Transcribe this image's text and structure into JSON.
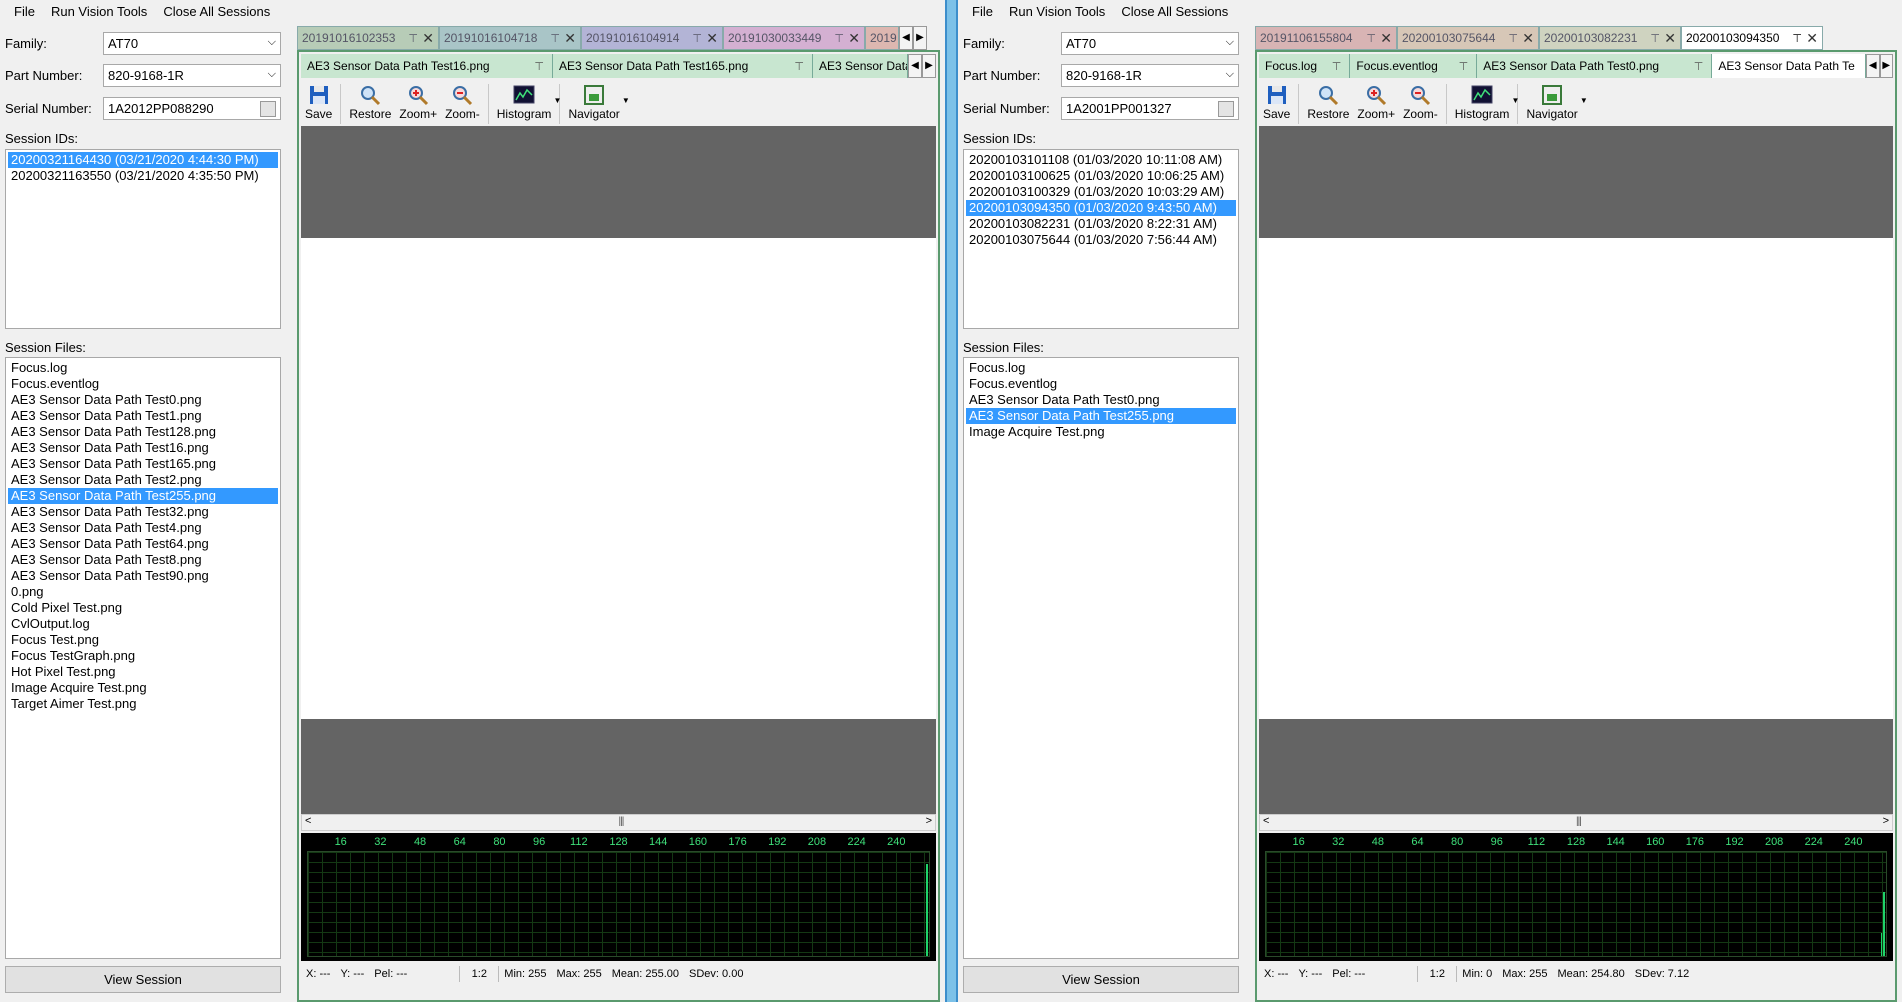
{
  "left": {
    "menu": [
      "File",
      "Run Vision Tools",
      "Close All Sessions"
    ],
    "family_label": "Family:",
    "family_value": "AT70",
    "part_label": "Part Number:",
    "part_value": "820-9168-1R",
    "serial_label": "Serial Number:",
    "serial_value": "1A2012PP088290",
    "session_ids_label": "Session IDs:",
    "session_ids": [
      "20200321164430 (03/21/2020 4:44:30 PM)",
      "20200321163550 (03/21/2020 4:35:50 PM)"
    ],
    "session_ids_selected": 0,
    "session_files_label": "Session Files:",
    "session_files": [
      "Focus.log",
      "Focus.eventlog",
      "AE3 Sensor Data Path Test0.png",
      "AE3 Sensor Data Path Test1.png",
      "AE3 Sensor Data Path Test128.png",
      "AE3 Sensor Data Path Test16.png",
      "AE3 Sensor Data Path Test165.png",
      "AE3 Sensor Data Path Test2.png",
      "AE3 Sensor Data Path Test255.png",
      "AE3 Sensor Data Path Test32.png",
      "AE3 Sensor Data Path Test4.png",
      "AE3 Sensor Data Path Test64.png",
      "AE3 Sensor Data Path Test8.png",
      "AE3 Sensor Data Path Test90.png",
      "0.png",
      "Cold Pixel Test.png",
      "CvlOutput.log",
      "Focus Test.png",
      "Focus TestGraph.png",
      "Hot Pixel Test.png",
      "Image Acquire Test.png",
      "Target Aimer Test.png"
    ],
    "session_files_selected": 8,
    "view_session": "View Session",
    "session_tabs": [
      {
        "label": "20191016102353",
        "color": "#b7ccb7"
      },
      {
        "label": "20191016104718",
        "color": "#a9c5c7"
      },
      {
        "label": "20191016104914",
        "color": "#b3b4d6"
      },
      {
        "label": "20191030033449",
        "color": "#d4b0d2"
      },
      {
        "label": "2019",
        "color": "#ddb7b0"
      }
    ],
    "file_tabs": [
      "AE3 Sensor Data Path Test16.png",
      "AE3 Sensor Data Path Test165.png",
      "AE3 Sensor Data"
    ],
    "toolbar": [
      "Save",
      "Restore",
      "Zoom+",
      "Zoom-",
      "Histogram",
      "Navigator"
    ],
    "histo_ticks": [
      "16",
      "32",
      "48",
      "64",
      "80",
      "96",
      "112",
      "128",
      "144",
      "160",
      "176",
      "192",
      "208",
      "224",
      "240"
    ],
    "status": {
      "x": "X: ---",
      "y": "Y: ---",
      "pel": "Pel: ---",
      "zoom": "1:2",
      "min": "Min: 255",
      "max": "Max: 255",
      "mean": "Mean: 255.00",
      "sdev": "SDev: 0.00"
    }
  },
  "right": {
    "menu": [
      "File",
      "Run Vision Tools",
      "Close All Sessions"
    ],
    "family_label": "Family:",
    "family_value": "AT70",
    "part_label": "Part Number:",
    "part_value": "820-9168-1R",
    "serial_label": "Serial Number:",
    "serial_value": "1A2001PP001327",
    "session_ids_label": "Session IDs:",
    "session_ids": [
      "20200103101108 (01/03/2020 10:11:08 AM)",
      "20200103100625 (01/03/2020 10:06:25 AM)",
      "20200103100329 (01/03/2020 10:03:29 AM)",
      "20200103094350 (01/03/2020 9:43:50 AM)",
      "20200103082231 (01/03/2020 8:22:31 AM)",
      "20200103075644 (01/03/2020 7:56:44 AM)"
    ],
    "session_ids_selected": 3,
    "session_files_label": "Session Files:",
    "session_files": [
      "Focus.log",
      "Focus.eventlog",
      "AE3 Sensor Data Path Test0.png",
      "AE3 Sensor Data Path Test255.png",
      "Image Acquire Test.png"
    ],
    "session_files_selected": 3,
    "view_session": "View Session",
    "session_tabs": [
      {
        "label": "20191106155804",
        "color": "#d8b4b4"
      },
      {
        "label": "20200103075644",
        "color": "#d7c7b7"
      },
      {
        "label": "20200103082231",
        "color": "#cfd3c0"
      },
      {
        "label": "20200103094350",
        "color": "#ffffff"
      }
    ],
    "file_tabs": [
      "Focus.log",
      "Focus.eventlog",
      "AE3 Sensor Data Path Test0.png",
      "AE3 Sensor Data Path Te"
    ],
    "toolbar": [
      "Save",
      "Restore",
      "Zoom+",
      "Zoom-",
      "Histogram",
      "Navigator"
    ],
    "histo_ticks": [
      "16",
      "32",
      "48",
      "64",
      "80",
      "96",
      "112",
      "128",
      "144",
      "160",
      "176",
      "192",
      "208",
      "224",
      "240"
    ],
    "status": {
      "x": "X: ---",
      "y": "Y: ---",
      "pel": "Pel: ---",
      "zoom": "1:2",
      "min": "Min: 0",
      "max": "Max: 255",
      "mean": "Mean: 254.80",
      "sdev": "SDev: 7.12"
    }
  }
}
